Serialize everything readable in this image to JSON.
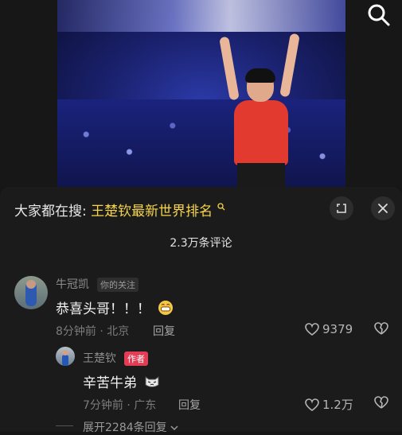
{
  "video": {
    "search_icon": "search-icon"
  },
  "panel": {
    "hot_search_prefix": "大家都在搜:",
    "hot_search_keyword": "王楚钦最新世界排名",
    "comment_count": "2.3万条评论"
  },
  "comments": [
    {
      "user": "牛冠凯",
      "badge": "你的关注",
      "text": "恭喜头哥！！！",
      "emoji": "grinning-emoji",
      "time": "8分钟前",
      "location": "北京",
      "reply_label": "回复",
      "likes": "9379"
    }
  ],
  "reply": {
    "user": "王楚钦",
    "badge": "作者",
    "text": "辛苦牛弟",
    "emoji": "cat-emoji",
    "time": "7分钟前",
    "location": "广东",
    "reply_label": "回复",
    "likes": "1.2万"
  },
  "expand_replies": "展开2284条回复",
  "colors": {
    "accent_keyword": "#f7d54a",
    "author_badge": "#e23d55",
    "background": "#1b1b1b"
  }
}
